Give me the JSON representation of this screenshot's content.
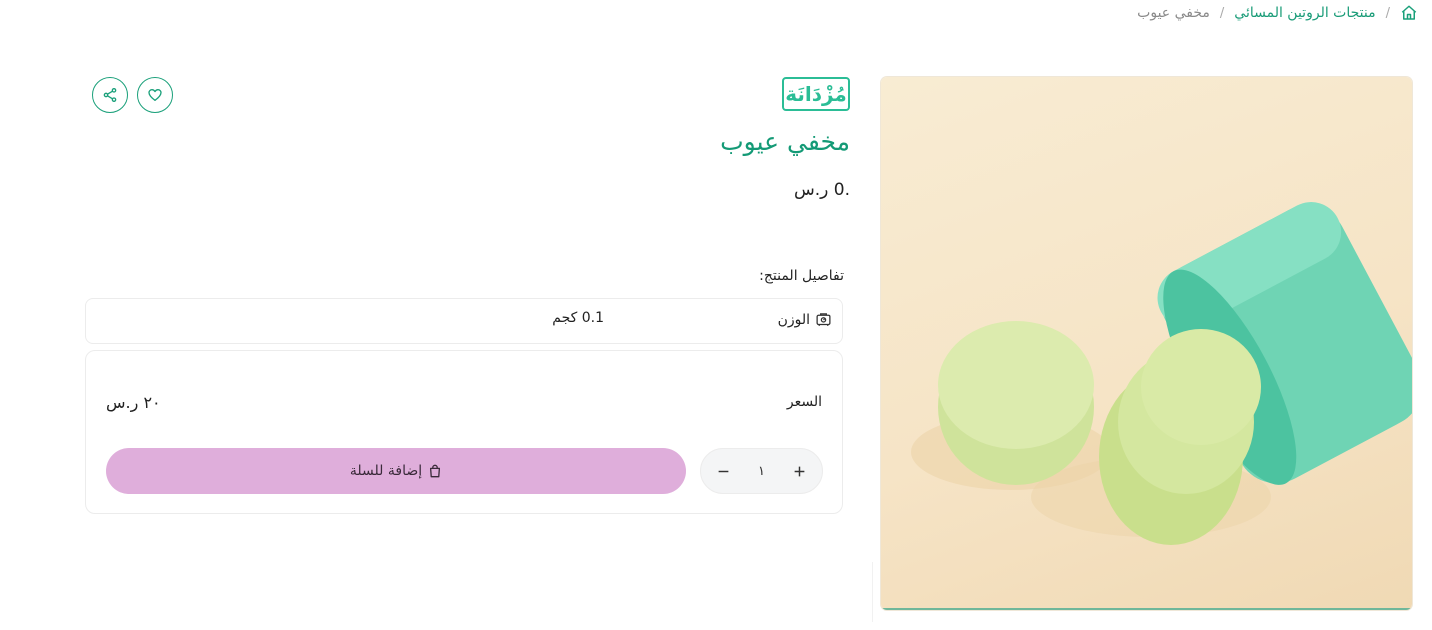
{
  "breadcrumb": {
    "home_icon": "home-icon",
    "separator": "/",
    "category": "منتجات الروتين المسائي",
    "current": "مخفي عيوب"
  },
  "brand": {
    "logo_text": "مُزْدَانَة",
    "color": "#2bbd96"
  },
  "product": {
    "title": "مخفي عيوب",
    "price_top": ".0 ر.س",
    "details_heading": "تفاصيل المنتج:",
    "weight_label": "الوزن",
    "weight_value": "0.1 كجم",
    "price_label": "السعر",
    "price_value": "٢٠ ر.س",
    "quantity": "١",
    "add_to_cart_label": "إضافة للسلة"
  },
  "colors": {
    "accent": "#1aa07a",
    "title": "#149a76",
    "cart_button": "#dfaedb"
  },
  "icons": {
    "share": "share-icon",
    "favorite": "heart-icon",
    "weight": "scale-icon",
    "bag": "bag-icon",
    "plus": "plus-icon",
    "minus": "minus-icon"
  }
}
